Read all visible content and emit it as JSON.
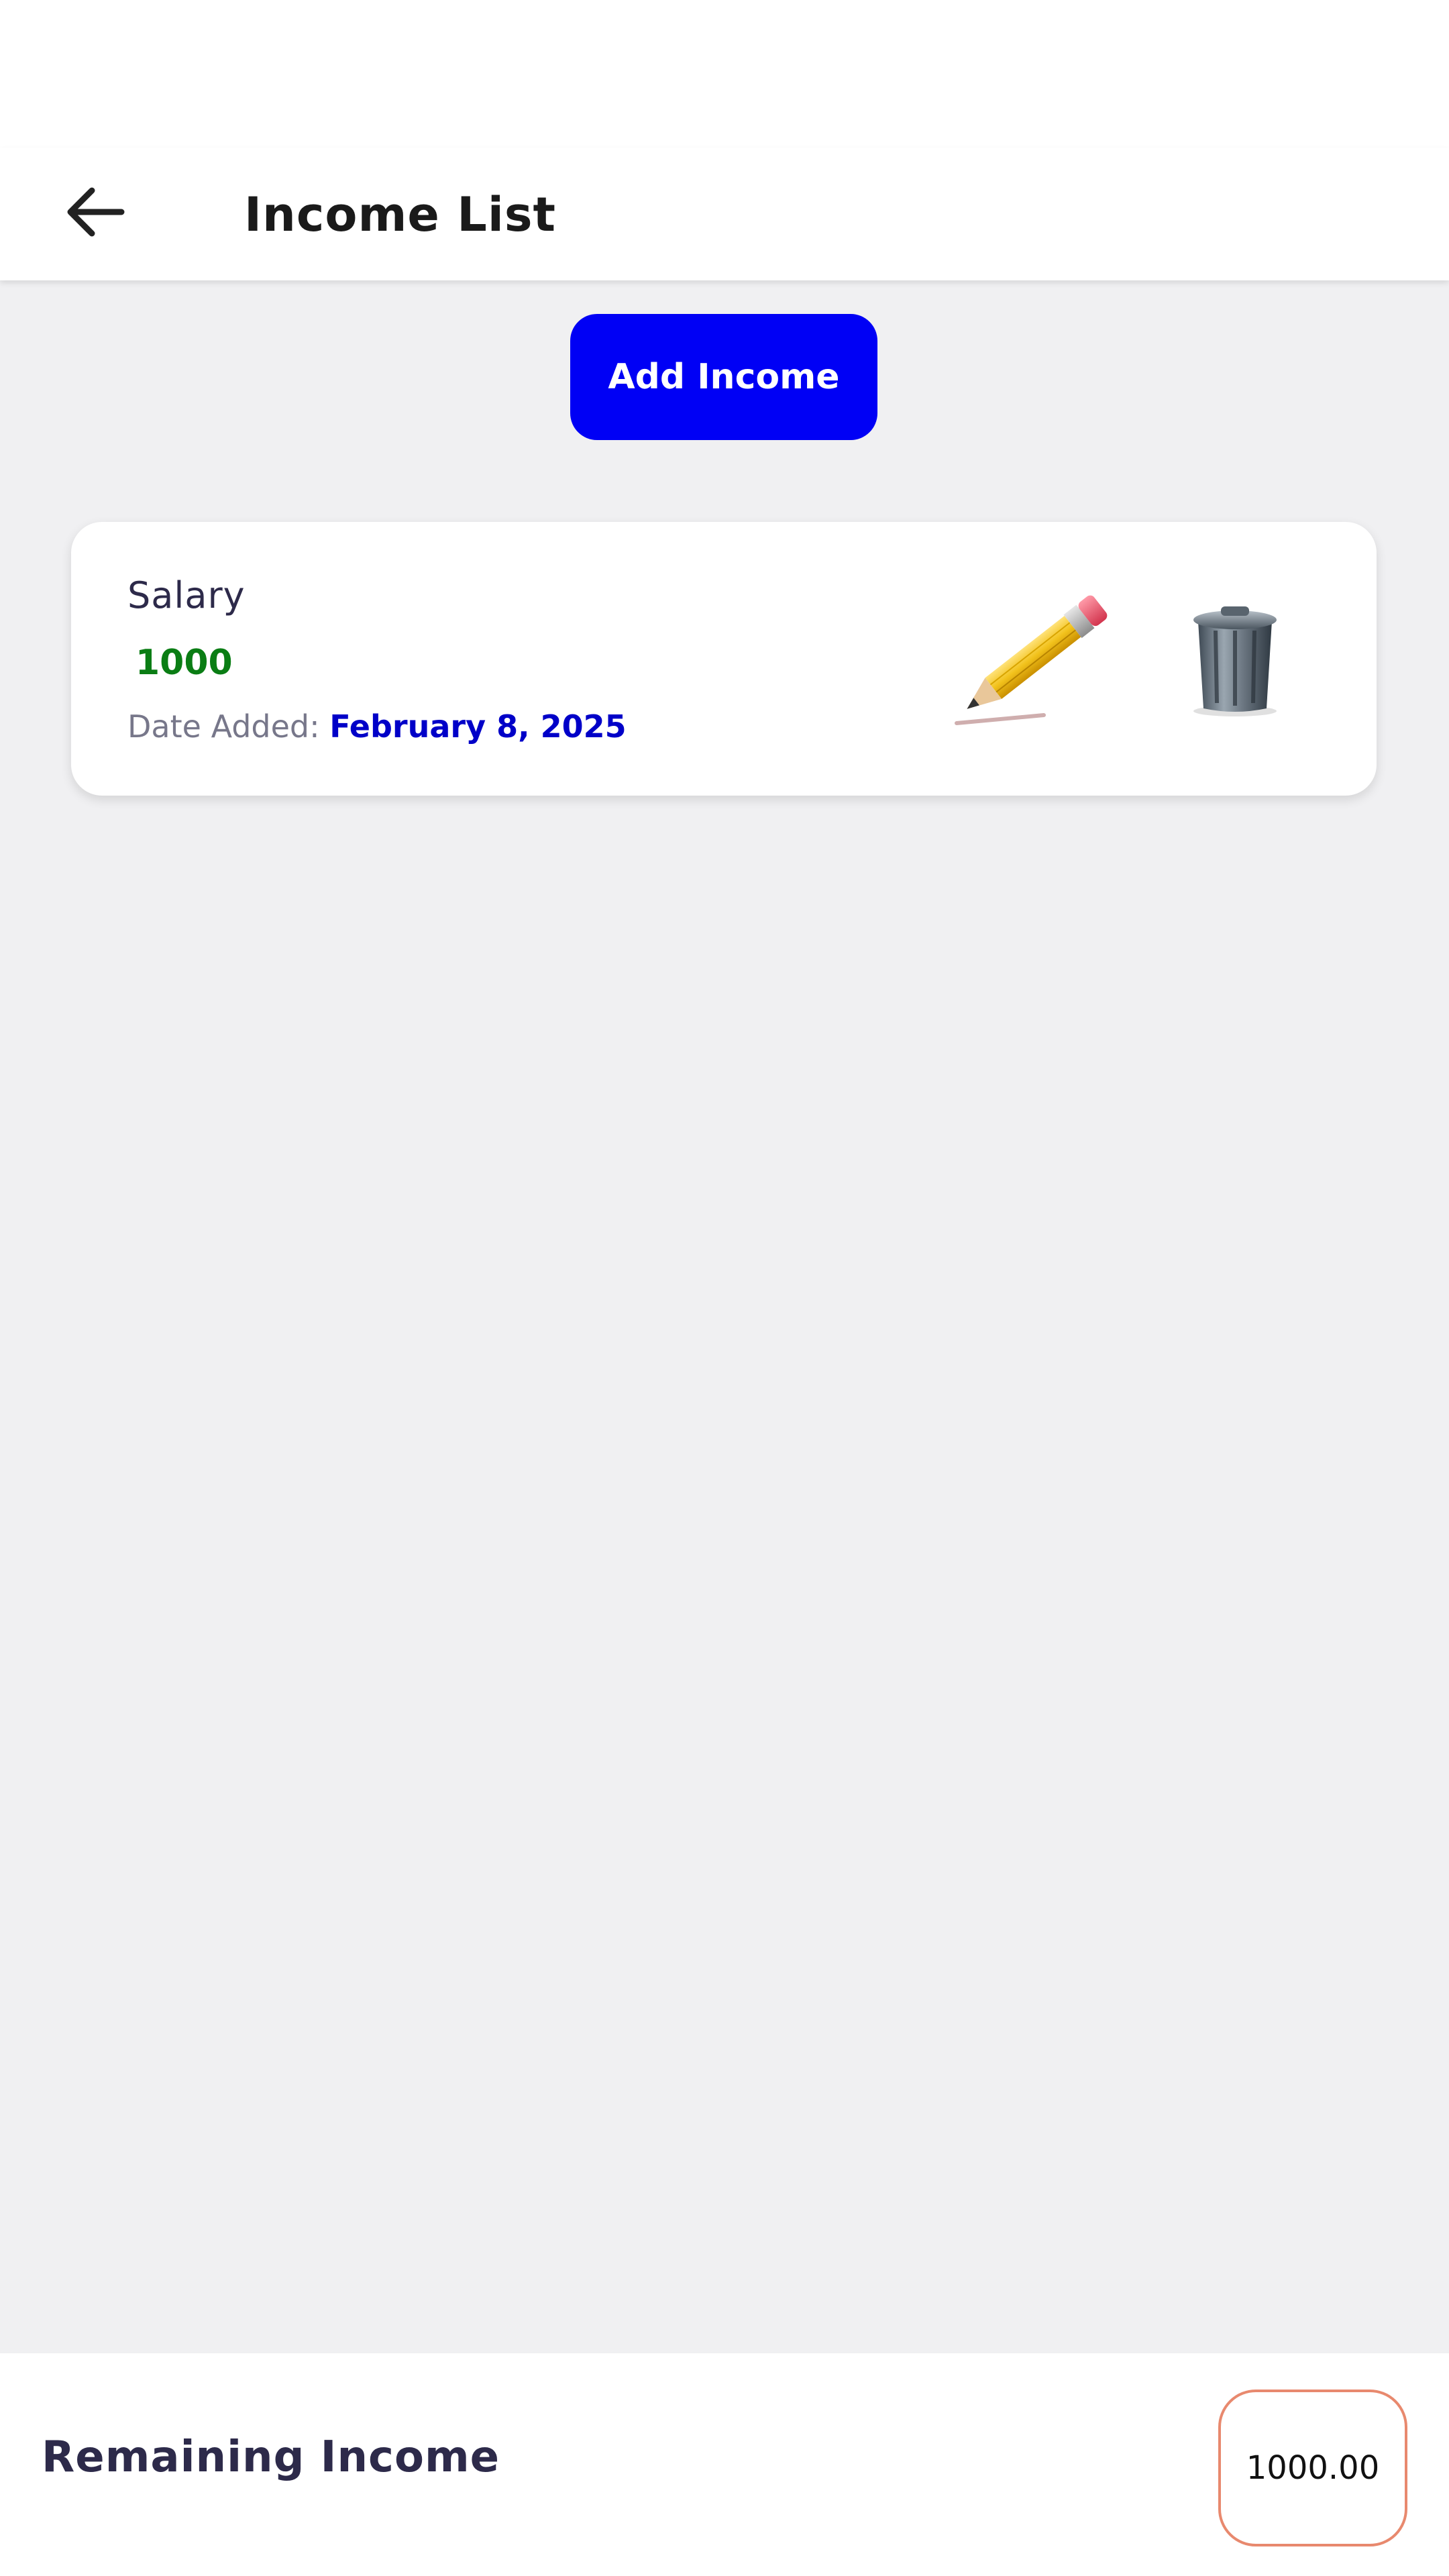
{
  "app_bar": {
    "title": "Income List",
    "back_icon": "arrow-left-icon"
  },
  "toolbar": {
    "add_label": "Add Income",
    "add_color": "#0000f5"
  },
  "income_items": [
    {
      "name": "Salary",
      "amount": "1000",
      "date_label": "Date Added:",
      "date_value": "February 8, 2025",
      "edit_icon": "pencil-icon",
      "delete_icon": "trash-can-icon"
    }
  ],
  "footer": {
    "remaining_label": "Remaining Income",
    "remaining_value": "1000.00",
    "badge_border_color": "#e8896e"
  },
  "colors": {
    "background": "#f0f0f2",
    "amount": "#0a7d14",
    "date_value": "#0000c8"
  }
}
